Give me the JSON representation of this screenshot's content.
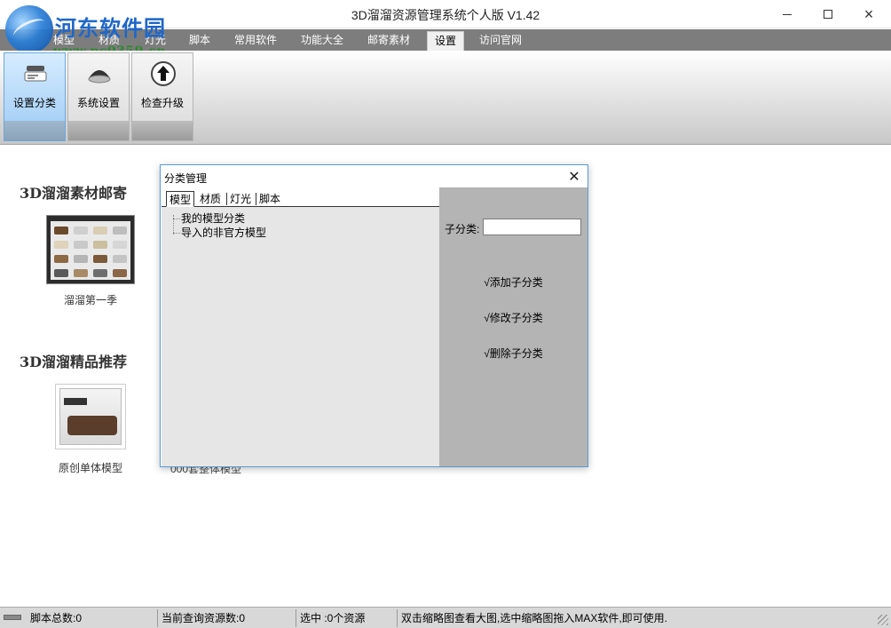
{
  "window": {
    "title": "3D溜溜资源管理系统个人版 V1.42",
    "controls": {
      "minimize": "minimize",
      "maximize": "maximize",
      "close": "×"
    }
  },
  "watermark": {
    "name": "河东软件园",
    "url": "www.pc0359.cn"
  },
  "menu": {
    "tabs": [
      "模型",
      "材质",
      "灯光",
      "脚本",
      "常用软件",
      "功能大全",
      "邮寄素材",
      "设置",
      "访问官网"
    ],
    "active_index": 7
  },
  "ribbon": {
    "buttons": [
      {
        "label": "设置分类",
        "icon": "category-settings-icon",
        "active": true
      },
      {
        "label": "系统设置",
        "icon": "system-settings-icon",
        "active": false
      },
      {
        "label": "检查升级",
        "icon": "upgrade-arrow-icon",
        "active": false
      }
    ]
  },
  "main": {
    "sections": [
      {
        "title": "3D溜溜素材邮寄",
        "item_caption": "溜溜第一季"
      },
      {
        "title": "3D溜溜精品推荐",
        "item_caption": "原创单体模型",
        "second_caption": "000套整体模型"
      }
    ]
  },
  "dialog": {
    "title": "分类管理",
    "close": "✕",
    "tabs": [
      "模型",
      "材质",
      "灯光",
      "脚本"
    ],
    "active_tab": 0,
    "tree": [
      "我的模型分类",
      "导入的非官方模型"
    ],
    "sub_label": "子分类:",
    "sub_value": "",
    "actions": [
      "√添加子分类",
      "√修改子分类",
      "√删除子分类"
    ]
  },
  "status": {
    "script_total": "脚本总数:0",
    "query_count": "当前查询资源数:0",
    "selected": "选中 :0个资源",
    "hint": "双击缩略图查看大图,选中缩略图拖入MAX软件,即可使用."
  },
  "colors": {
    "menubar": "#7d7d7d",
    "ribbon_active": "#9ccaf5",
    "dialog_border": "#5a9ad8",
    "dialog_right_panel": "#b4b4b4",
    "dialog_left_panel": "#e6e6e6"
  }
}
